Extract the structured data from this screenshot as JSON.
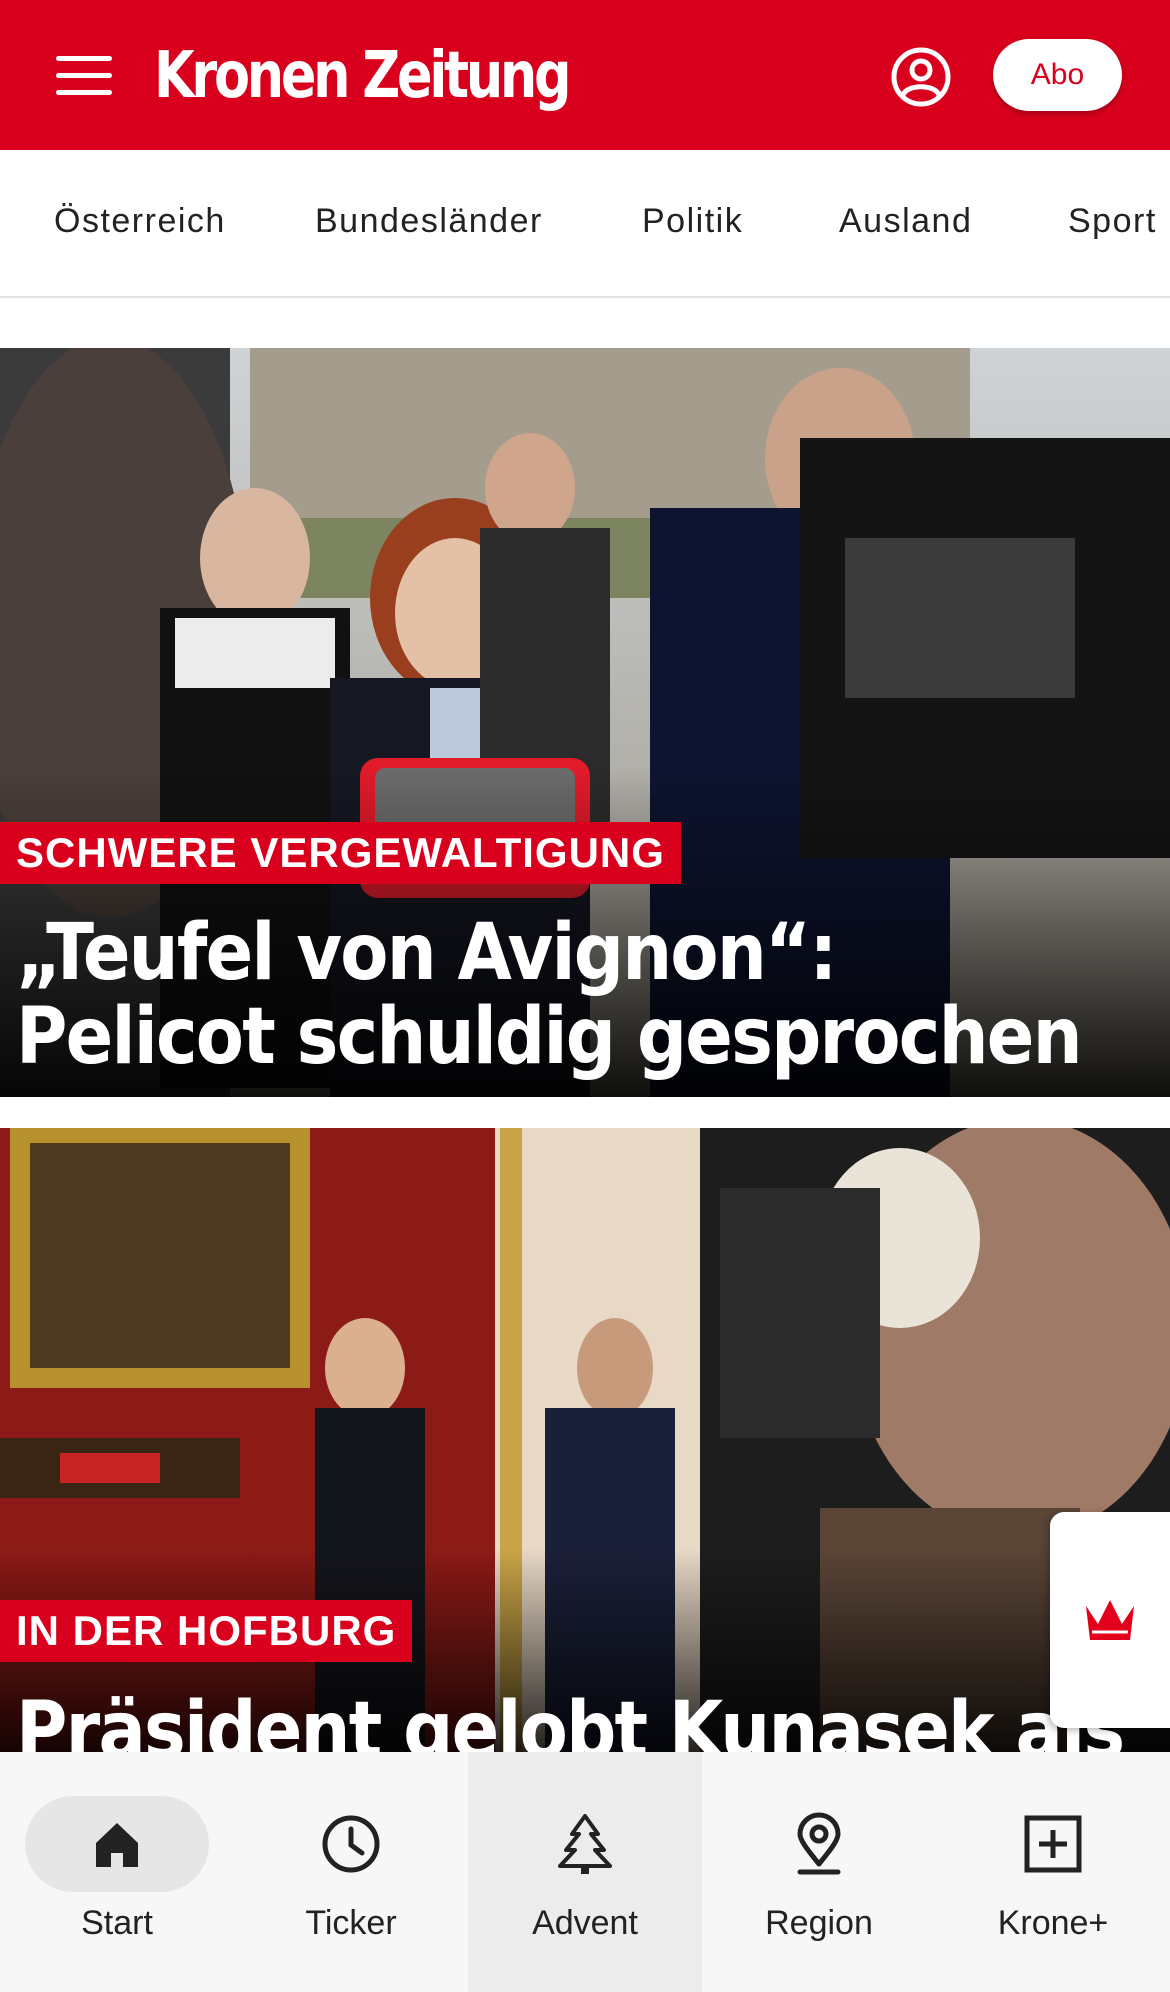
{
  "header": {
    "logo": "Kronen Zeitung",
    "abo_label": "Abo",
    "brand_color": "#d8001c"
  },
  "categories": [
    "Österreich",
    "Bundesländer",
    "Politik",
    "Ausland",
    "Sport"
  ],
  "articles": [
    {
      "kicker": "SCHWERE VERGEWALTIGUNG",
      "headline_line1": "„Teufel von Avignon“:",
      "headline_line2": "Pelicot schuldig gesprochen"
    },
    {
      "kicker": "IN DER HOFBURG",
      "headline_line1": "Präsident gelobt Kunasek als"
    }
  ],
  "bottom_nav": {
    "items": [
      {
        "label": "Start",
        "icon": "home-icon"
      },
      {
        "label": "Ticker",
        "icon": "clock-icon"
      },
      {
        "label": "Advent",
        "icon": "tree-icon"
      },
      {
        "label": "Region",
        "icon": "location-pin-icon"
      },
      {
        "label": "Krone+",
        "icon": "plus-box-icon"
      }
    ],
    "active": "Start"
  }
}
